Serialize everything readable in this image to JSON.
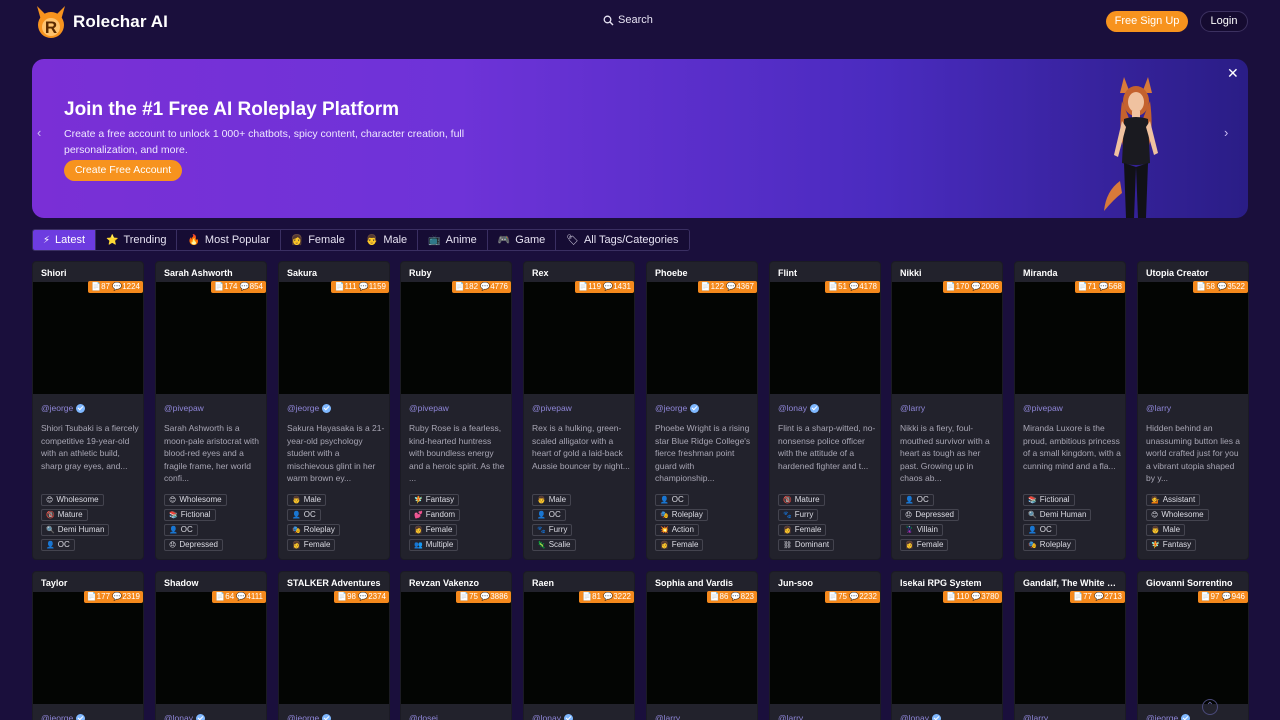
{
  "header": {
    "brand": "Rolechar AI",
    "search_label": "Search",
    "signup_label": "Free Sign Up",
    "login_label": "Login"
  },
  "banner": {
    "title": "Join the #1 Free AI Roleplay Platform",
    "subtitle": "Create a free account to unlock 1 000+ chatbots, spicy content, character creation, full personalization, and more.",
    "cta_label": "Create Free Account"
  },
  "tabs": [
    {
      "label": "Latest",
      "icon": "lightning-icon",
      "glyph": "⚡",
      "active": true
    },
    {
      "label": "Trending",
      "icon": "star-icon",
      "glyph": "⭐"
    },
    {
      "label": "Most Popular",
      "icon": "fire-icon",
      "glyph": "🔥"
    },
    {
      "label": "Female",
      "icon": "female-face-icon",
      "glyph": "👩"
    },
    {
      "label": "Male",
      "icon": "male-face-icon",
      "glyph": "👨"
    },
    {
      "label": "Anime",
      "icon": "tv-icon",
      "glyph": "📺"
    },
    {
      "label": "Game",
      "icon": "gamepad-icon",
      "glyph": "🎮"
    },
    {
      "label": "All Tags/Categories",
      "icon": "tags-icon",
      "glyph": "🏷"
    }
  ],
  "cards_row1": [
    {
      "name": "Shiori",
      "msgs": "87",
      "chats": "1224",
      "author": "@jeorge",
      "verified": true,
      "desc": "Shiori Tsubaki is a fiercely competitive 19-year-old with an athletic build, sharp gray eyes, and...",
      "tags": [
        {
          "g": "😊",
          "t": "Wholesome"
        },
        {
          "g": "🔞",
          "t": "Mature"
        },
        {
          "g": "🔍",
          "t": "Demi Human"
        },
        {
          "g": "👤",
          "t": "OC"
        }
      ]
    },
    {
      "name": "Sarah Ashworth",
      "msgs": "174",
      "chats": "854",
      "author": "@pivepaw",
      "verified": false,
      "desc": "Sarah Ashworth is a moon-pale aristocrat with blood-red eyes and a fragile frame, her world confi...",
      "tags": [
        {
          "g": "😊",
          "t": "Wholesome"
        },
        {
          "g": "📚",
          "t": "Fictional"
        },
        {
          "g": "👤",
          "t": "OC"
        },
        {
          "g": "😞",
          "t": "Depressed"
        }
      ]
    },
    {
      "name": "Sakura",
      "msgs": "111",
      "chats": "1159",
      "author": "@jeorge",
      "verified": true,
      "desc": "Sakura Hayasaka is a 21-year-old psychology student with a mischievous glint in her warm brown ey...",
      "tags": [
        {
          "g": "👨",
          "t": "Male"
        },
        {
          "g": "👤",
          "t": "OC"
        },
        {
          "g": "🎭",
          "t": "Roleplay"
        },
        {
          "g": "👩",
          "t": "Female"
        }
      ]
    },
    {
      "name": "Ruby",
      "msgs": "182",
      "chats": "4776",
      "author": "@pivepaw",
      "verified": false,
      "desc": "Ruby Rose is a fearless, kind-hearted huntress with boundless energy and a heroic spirit. As the ...",
      "tags": [
        {
          "g": "🧚",
          "t": "Fantasy"
        },
        {
          "g": "💕",
          "t": "Fandom"
        },
        {
          "g": "👩",
          "t": "Female"
        },
        {
          "g": "👥",
          "t": "Multiple"
        }
      ]
    },
    {
      "name": "Rex",
      "msgs": "119",
      "chats": "1431",
      "author": "@pivepaw",
      "verified": false,
      "desc": "Rex is a hulking, green-scaled alligator with a heart of gold a laid-back Aussie bouncer by night...",
      "tags": [
        {
          "g": "👨",
          "t": "Male"
        },
        {
          "g": "👤",
          "t": "OC"
        },
        {
          "g": "🐾",
          "t": "Furry"
        },
        {
          "g": "🦎",
          "t": "Scalie"
        }
      ]
    },
    {
      "name": "Phoebe",
      "msgs": "122",
      "chats": "4367",
      "author": "@jeorge",
      "verified": true,
      "desc": "Phoebe Wright is a rising star Blue Ridge College's fierce freshman point guard with championship...",
      "tags": [
        {
          "g": "👤",
          "t": "OC"
        },
        {
          "g": "🎭",
          "t": "Roleplay"
        },
        {
          "g": "💥",
          "t": "Action"
        },
        {
          "g": "👩",
          "t": "Female"
        }
      ]
    },
    {
      "name": "Flint",
      "msgs": "51",
      "chats": "4178",
      "author": "@lonay",
      "verified": true,
      "desc": "Flint is a sharp-witted, no-nonsense police officer with the attitude of a hardened fighter and t...",
      "tags": [
        {
          "g": "🔞",
          "t": "Mature"
        },
        {
          "g": "🐾",
          "t": "Furry"
        },
        {
          "g": "👩",
          "t": "Female"
        },
        {
          "g": "⛓",
          "t": "Dominant"
        }
      ]
    },
    {
      "name": "Nikki",
      "msgs": "170",
      "chats": "2006",
      "author": "@larry",
      "verified": false,
      "desc": "Nikki is a fiery, foul-mouthed survivor with a heart as tough as her past. Growing up in chaos ab...",
      "tags": [
        {
          "g": "👤",
          "t": "OC"
        },
        {
          "g": "😞",
          "t": "Depressed"
        },
        {
          "g": "🦹",
          "t": "Villain"
        },
        {
          "g": "👩",
          "t": "Female"
        }
      ]
    },
    {
      "name": "Miranda",
      "msgs": "71",
      "chats": "568",
      "author": "@pivepaw",
      "verified": false,
      "desc": "Miranda Luxore is the proud, ambitious princess of a small kingdom, with a cunning mind and a fla...",
      "tags": [
        {
          "g": "📚",
          "t": "Fictional"
        },
        {
          "g": "🔍",
          "t": "Demi Human"
        },
        {
          "g": "👤",
          "t": "OC"
        },
        {
          "g": "🎭",
          "t": "Roleplay"
        }
      ]
    },
    {
      "name": "Utopia Creator",
      "msgs": "58",
      "chats": "3522",
      "author": "@larry",
      "verified": false,
      "desc": "Hidden behind an unassuming button lies a world crafted just for you a vibrant utopia shaped by y...",
      "tags": [
        {
          "g": "💁",
          "t": "Assistant"
        },
        {
          "g": "😊",
          "t": "Wholesome"
        },
        {
          "g": "👨",
          "t": "Male"
        },
        {
          "g": "🧚",
          "t": "Fantasy"
        }
      ]
    }
  ],
  "cards_row2": [
    {
      "name": "Taylor",
      "msgs": "177",
      "chats": "2319",
      "author": "@jeorge",
      "verified": true
    },
    {
      "name": "Shadow",
      "msgs": "64",
      "chats": "4111",
      "author": "@lonay",
      "verified": true
    },
    {
      "name": "STALKER Adventures",
      "msgs": "98",
      "chats": "2374",
      "author": "@jeorge",
      "verified": true
    },
    {
      "name": "Revzan Vakenzo",
      "msgs": "75",
      "chats": "3886",
      "author": "@dosei",
      "verified": false
    },
    {
      "name": "Raen",
      "msgs": "81",
      "chats": "3222",
      "author": "@lonay",
      "verified": true
    },
    {
      "name": "Sophia and Vardis",
      "msgs": "86",
      "chats": "823",
      "author": "@larry",
      "verified": false
    },
    {
      "name": "Jun-soo",
      "msgs": "75",
      "chats": "2232",
      "author": "@larry",
      "verified": false
    },
    {
      "name": "Isekai RPG System",
      "msgs": "110",
      "chats": "3780",
      "author": "@lonay",
      "verified": true
    },
    {
      "name": "Gandalf, The White Wi...",
      "msgs": "77",
      "chats": "2713",
      "author": "@larry",
      "verified": false
    },
    {
      "name": "Giovanni Sorrentino",
      "msgs": "97",
      "chats": "946",
      "author": "@jeorge",
      "verified": true
    }
  ],
  "colors": {
    "accent": "#f7931e",
    "active_tab": "#6d3ce0",
    "background": "#1a0f3c"
  }
}
